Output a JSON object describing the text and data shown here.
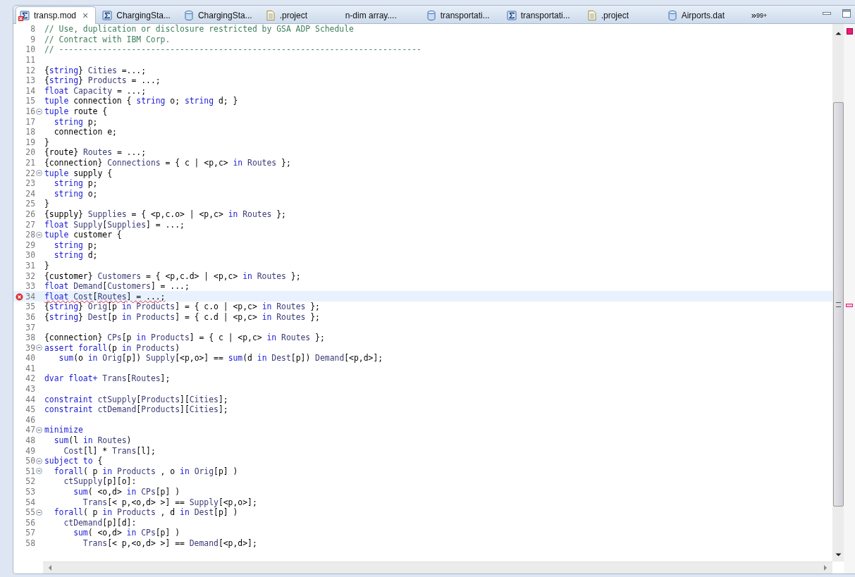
{
  "tabs": [
    {
      "label": "transp.mod",
      "kind": "model",
      "error": true,
      "selected": true,
      "close": "×"
    },
    {
      "label": "ChargingSta...",
      "kind": "model",
      "error": false,
      "selected": false
    },
    {
      "label": "ChargingSta...",
      "kind": "data",
      "error": false,
      "selected": false
    },
    {
      "label": ".project",
      "kind": "file",
      "error": false,
      "selected": false
    },
    {
      "label": "n-dim array....",
      "kind": "plain",
      "error": false,
      "selected": false
    },
    {
      "label": "transportati...",
      "kind": "data",
      "error": false,
      "selected": false
    },
    {
      "label": "transportati...",
      "kind": "model",
      "error": false,
      "selected": false
    },
    {
      "label": ".project",
      "kind": "file",
      "error": false,
      "selected": false
    },
    {
      "label": "Airports.dat",
      "kind": "data",
      "error": false,
      "selected": false
    }
  ],
  "overflow": {
    "chevron": "»",
    "count": "99+"
  },
  "lines": [
    {
      "n": "8",
      "fold": false,
      "error": false,
      "s": [
        {
          "kind": "comment",
          "text": "// Use, duplication or disclosure restricted by GSA ADP Schedule"
        }
      ]
    },
    {
      "n": "9",
      "fold": false,
      "error": false,
      "s": [
        {
          "kind": "comment",
          "text": "// Contract with IBM Corp."
        }
      ]
    },
    {
      "n": "10",
      "fold": false,
      "error": false,
      "s": [
        {
          "kind": "comment",
          "text": "// ---------------------------------------------------------------------------"
        }
      ]
    },
    {
      "n": "11",
      "fold": false,
      "error": false
    },
    {
      "n": "12",
      "fold": false,
      "error": false,
      "s": [
        {
          "kind": "plain",
          "text": "{"
        },
        {
          "kind": "kw",
          "text": "string"
        },
        {
          "kind": "plain",
          "text": "} "
        },
        {
          "kind": "name",
          "text": "Cities"
        },
        {
          "kind": "plain",
          "text": " =...;"
        }
      ]
    },
    {
      "n": "13",
      "fold": false,
      "error": false,
      "s": [
        {
          "kind": "plain",
          "text": "{"
        },
        {
          "kind": "kw",
          "text": "string"
        },
        {
          "kind": "plain",
          "text": "} "
        },
        {
          "kind": "name",
          "text": "Products"
        },
        {
          "kind": "plain",
          "text": " = ...;"
        }
      ]
    },
    {
      "n": "14",
      "fold": false,
      "error": false,
      "s": [
        {
          "kind": "kw",
          "text": "float"
        },
        {
          "kind": "name",
          "text": " Capacity"
        },
        {
          "kind": "plain",
          "text": " = ...;"
        }
      ]
    },
    {
      "n": "15",
      "fold": false,
      "error": false,
      "s": [
        {
          "kind": "kw",
          "text": "tuple"
        },
        {
          "kind": "plain",
          "text": " connection { "
        },
        {
          "kind": "kw",
          "text": "string"
        },
        {
          "kind": "plain",
          "text": " o; "
        },
        {
          "kind": "kw",
          "text": "string"
        },
        {
          "kind": "plain",
          "text": " d; }"
        }
      ]
    },
    {
      "n": "16",
      "fold": true,
      "error": false,
      "s": [
        {
          "kind": "kw",
          "text": "tuple"
        },
        {
          "kind": "plain",
          "text": " route {"
        }
      ]
    },
    {
      "n": "17",
      "fold": false,
      "error": false,
      "s": [
        {
          "kind": "kw",
          "text": "  string"
        },
        {
          "kind": "plain",
          "text": " p;"
        }
      ]
    },
    {
      "n": "18",
      "fold": false,
      "error": false,
      "s": [
        {
          "kind": "plain",
          "text": "  connection e;"
        }
      ]
    },
    {
      "n": "19",
      "fold": false,
      "error": false,
      "s": [
        {
          "kind": "plain",
          "text": "}"
        }
      ]
    },
    {
      "n": "20",
      "fold": false,
      "error": false,
      "s": [
        {
          "kind": "plain",
          "text": "{route} "
        },
        {
          "kind": "name",
          "text": "Routes"
        },
        {
          "kind": "plain",
          "text": " = ...;"
        }
      ]
    },
    {
      "n": "21",
      "fold": false,
      "error": false,
      "s": [
        {
          "kind": "plain",
          "text": "{connection} "
        },
        {
          "kind": "name",
          "text": "Connections"
        },
        {
          "kind": "plain",
          "text": " = { c | <p,c> "
        },
        {
          "kind": "kw",
          "text": "in"
        },
        {
          "kind": "name",
          "text": " Routes"
        },
        {
          "kind": "plain",
          "text": " };"
        }
      ]
    },
    {
      "n": "22",
      "fold": true,
      "error": false,
      "s": [
        {
          "kind": "kw",
          "text": "tuple"
        },
        {
          "kind": "plain",
          "text": " supply {"
        }
      ]
    },
    {
      "n": "23",
      "fold": false,
      "error": false,
      "s": [
        {
          "kind": "kw",
          "text": "  string"
        },
        {
          "kind": "plain",
          "text": " p;"
        }
      ]
    },
    {
      "n": "24",
      "fold": false,
      "error": false,
      "s": [
        {
          "kind": "kw",
          "text": "  string"
        },
        {
          "kind": "plain",
          "text": " o;"
        }
      ]
    },
    {
      "n": "25",
      "fold": false,
      "error": false,
      "s": [
        {
          "kind": "plain",
          "text": "}"
        }
      ]
    },
    {
      "n": "26",
      "fold": false,
      "error": false,
      "s": [
        {
          "kind": "plain",
          "text": "{supply} "
        },
        {
          "kind": "name",
          "text": "Supplies"
        },
        {
          "kind": "plain",
          "text": " = { <p,c.o> | <p,c> "
        },
        {
          "kind": "kw",
          "text": "in"
        },
        {
          "kind": "name",
          "text": " Routes"
        },
        {
          "kind": "plain",
          "text": " };"
        }
      ]
    },
    {
      "n": "27",
      "fold": false,
      "error": false,
      "s": [
        {
          "kind": "kw",
          "text": "float"
        },
        {
          "kind": "name",
          "text": " Supply"
        },
        {
          "kind": "plain",
          "text": "["
        },
        {
          "kind": "name",
          "text": "Supplies"
        },
        {
          "kind": "plain",
          "text": "] = ...;"
        }
      ]
    },
    {
      "n": "28",
      "fold": true,
      "error": false,
      "s": [
        {
          "kind": "kw",
          "text": "tuple"
        },
        {
          "kind": "plain",
          "text": " customer {"
        }
      ]
    },
    {
      "n": "29",
      "fold": false,
      "error": false,
      "s": [
        {
          "kind": "kw",
          "text": "  string"
        },
        {
          "kind": "plain",
          "text": " p;"
        }
      ]
    },
    {
      "n": "30",
      "fold": false,
      "error": false,
      "s": [
        {
          "kind": "kw",
          "text": "  string"
        },
        {
          "kind": "plain",
          "text": " d;"
        }
      ]
    },
    {
      "n": "31",
      "fold": false,
      "error": false,
      "s": [
        {
          "kind": "plain",
          "text": "}"
        }
      ]
    },
    {
      "n": "32",
      "fold": false,
      "error": false,
      "s": [
        {
          "kind": "plain",
          "text": "{customer} "
        },
        {
          "kind": "name",
          "text": "Customers"
        },
        {
          "kind": "plain",
          "text": " = { <p,c.d> | <p,c> "
        },
        {
          "kind": "kw",
          "text": "in"
        },
        {
          "kind": "name",
          "text": " Routes"
        },
        {
          "kind": "plain",
          "text": " };"
        }
      ]
    },
    {
      "n": "33",
      "fold": false,
      "error": false,
      "s": [
        {
          "kind": "kw",
          "text": "float"
        },
        {
          "kind": "name",
          "text": " Demand"
        },
        {
          "kind": "plain",
          "text": "["
        },
        {
          "kind": "name",
          "text": "Customers"
        },
        {
          "kind": "plain",
          "text": "] = ...;"
        }
      ]
    },
    {
      "n": "34",
      "fold": false,
      "error": true,
      "s": [
        {
          "kind": "kw",
          "text": "float"
        },
        {
          "kind": "name",
          "text": " Cost"
        },
        {
          "kind": "plain",
          "text": "["
        },
        {
          "kind": "name",
          "text": "Routes"
        },
        {
          "kind": "plain",
          "text": "] = ...;"
        }
      ]
    },
    {
      "n": "35",
      "fold": false,
      "error": false,
      "s": [
        {
          "kind": "plain",
          "text": "{"
        },
        {
          "kind": "kw",
          "text": "string"
        },
        {
          "kind": "plain",
          "text": "} "
        },
        {
          "kind": "name",
          "text": "Orig"
        },
        {
          "kind": "plain",
          "text": "[p "
        },
        {
          "kind": "kw",
          "text": "in"
        },
        {
          "kind": "name",
          "text": " Products"
        },
        {
          "kind": "plain",
          "text": "] = { c.o | <p,c> "
        },
        {
          "kind": "kw",
          "text": "in"
        },
        {
          "kind": "name",
          "text": " Routes"
        },
        {
          "kind": "plain",
          "text": " };"
        }
      ]
    },
    {
      "n": "36",
      "fold": false,
      "error": false,
      "s": [
        {
          "kind": "plain",
          "text": "{"
        },
        {
          "kind": "kw",
          "text": "string"
        },
        {
          "kind": "plain",
          "text": "} "
        },
        {
          "kind": "name",
          "text": "Dest"
        },
        {
          "kind": "plain",
          "text": "[p "
        },
        {
          "kind": "kw",
          "text": "in"
        },
        {
          "kind": "name",
          "text": " Products"
        },
        {
          "kind": "plain",
          "text": "] = { c.d | <p,c> "
        },
        {
          "kind": "kw",
          "text": "in"
        },
        {
          "kind": "name",
          "text": " Routes"
        },
        {
          "kind": "plain",
          "text": " };"
        }
      ]
    },
    {
      "n": "37",
      "fold": false,
      "error": false
    },
    {
      "n": "38",
      "fold": false,
      "error": false,
      "s": [
        {
          "kind": "plain",
          "text": "{connection} "
        },
        {
          "kind": "name",
          "text": "CPs"
        },
        {
          "kind": "plain",
          "text": "[p "
        },
        {
          "kind": "kw",
          "text": "in"
        },
        {
          "kind": "name",
          "text": " Products"
        },
        {
          "kind": "plain",
          "text": "] = { c | <p,c> "
        },
        {
          "kind": "kw",
          "text": "in"
        },
        {
          "kind": "name",
          "text": " Routes"
        },
        {
          "kind": "plain",
          "text": " };"
        }
      ]
    },
    {
      "n": "39",
      "fold": true,
      "error": false,
      "s": [
        {
          "kind": "kw",
          "text": "assert forall"
        },
        {
          "kind": "plain",
          "text": "(p "
        },
        {
          "kind": "kw",
          "text": "in"
        },
        {
          "kind": "name",
          "text": " Products"
        },
        {
          "kind": "plain",
          "text": ")"
        }
      ]
    },
    {
      "n": "40",
      "fold": false,
      "error": false,
      "s": [
        {
          "kind": "kw",
          "text": "   sum"
        },
        {
          "kind": "plain",
          "text": "(o "
        },
        {
          "kind": "kw",
          "text": "in"
        },
        {
          "kind": "name",
          "text": " Orig"
        },
        {
          "kind": "plain",
          "text": "[p]) "
        },
        {
          "kind": "name",
          "text": "Supply"
        },
        {
          "kind": "plain",
          "text": "[<p,o>] == "
        },
        {
          "kind": "kw",
          "text": "sum"
        },
        {
          "kind": "plain",
          "text": "(d "
        },
        {
          "kind": "kw",
          "text": "in"
        },
        {
          "kind": "name",
          "text": " Dest"
        },
        {
          "kind": "plain",
          "text": "[p]) "
        },
        {
          "kind": "name",
          "text": "Demand"
        },
        {
          "kind": "plain",
          "text": "[<p,d>];"
        }
      ]
    },
    {
      "n": "41",
      "fold": false,
      "error": false
    },
    {
      "n": "42",
      "fold": false,
      "error": false,
      "s": [
        {
          "kind": "kw",
          "text": "dvar float+"
        },
        {
          "kind": "name",
          "text": " Trans"
        },
        {
          "kind": "plain",
          "text": "["
        },
        {
          "kind": "name",
          "text": "Routes"
        },
        {
          "kind": "plain",
          "text": "];"
        }
      ]
    },
    {
      "n": "43",
      "fold": false,
      "error": false
    },
    {
      "n": "44",
      "fold": false,
      "error": false,
      "s": [
        {
          "kind": "kw",
          "text": "constraint"
        },
        {
          "kind": "name",
          "text": " ctSupply"
        },
        {
          "kind": "plain",
          "text": "["
        },
        {
          "kind": "name",
          "text": "Products"
        },
        {
          "kind": "plain",
          "text": "]["
        },
        {
          "kind": "name",
          "text": "Cities"
        },
        {
          "kind": "plain",
          "text": "];"
        }
      ]
    },
    {
      "n": "45",
      "fold": false,
      "error": false,
      "s": [
        {
          "kind": "kw",
          "text": "constraint"
        },
        {
          "kind": "name",
          "text": " ctDemand"
        },
        {
          "kind": "plain",
          "text": "["
        },
        {
          "kind": "name",
          "text": "Products"
        },
        {
          "kind": "plain",
          "text": "]["
        },
        {
          "kind": "name",
          "text": "Cities"
        },
        {
          "kind": "plain",
          "text": "];"
        }
      ]
    },
    {
      "n": "46",
      "fold": false,
      "error": false
    },
    {
      "n": "47",
      "fold": true,
      "error": false,
      "s": [
        {
          "kind": "kw",
          "text": "minimize"
        }
      ]
    },
    {
      "n": "48",
      "fold": false,
      "error": false,
      "s": [
        {
          "kind": "kw",
          "text": "  sum"
        },
        {
          "kind": "plain",
          "text": "(l "
        },
        {
          "kind": "kw",
          "text": "in"
        },
        {
          "kind": "name",
          "text": " Routes"
        },
        {
          "kind": "plain",
          "text": ")"
        }
      ]
    },
    {
      "n": "49",
      "fold": false,
      "error": false,
      "s": [
        {
          "kind": "name",
          "text": "    Cost"
        },
        {
          "kind": "plain",
          "text": "[l] * "
        },
        {
          "kind": "name",
          "text": "Trans"
        },
        {
          "kind": "plain",
          "text": "[l];"
        }
      ]
    },
    {
      "n": "50",
      "fold": true,
      "error": false,
      "s": [
        {
          "kind": "kw",
          "text": "subject to"
        },
        {
          "kind": "plain",
          "text": " {"
        }
      ]
    },
    {
      "n": "51",
      "fold": true,
      "error": false,
      "s": [
        {
          "kind": "kw",
          "text": "  forall"
        },
        {
          "kind": "plain",
          "text": "( p "
        },
        {
          "kind": "kw",
          "text": "in"
        },
        {
          "kind": "name",
          "text": " Products"
        },
        {
          "kind": "plain",
          "text": " , o "
        },
        {
          "kind": "kw",
          "text": "in"
        },
        {
          "kind": "name",
          "text": " Orig"
        },
        {
          "kind": "plain",
          "text": "[p] )"
        }
      ]
    },
    {
      "n": "52",
      "fold": false,
      "error": false,
      "s": [
        {
          "kind": "name",
          "text": "    ctSupply"
        },
        {
          "kind": "plain",
          "text": "[p][o]:"
        }
      ]
    },
    {
      "n": "53",
      "fold": false,
      "error": false,
      "s": [
        {
          "kind": "kw",
          "text": "      sum"
        },
        {
          "kind": "plain",
          "text": "( <o,d> "
        },
        {
          "kind": "kw",
          "text": "in"
        },
        {
          "kind": "name",
          "text": " CPs"
        },
        {
          "kind": "plain",
          "text": "[p] )"
        }
      ]
    },
    {
      "n": "54",
      "fold": false,
      "error": false,
      "s": [
        {
          "kind": "name",
          "text": "        Trans"
        },
        {
          "kind": "plain",
          "text": "[< p,<o,d> >] == "
        },
        {
          "kind": "name",
          "text": "Supply"
        },
        {
          "kind": "plain",
          "text": "[<p,o>];"
        }
      ]
    },
    {
      "n": "55",
      "fold": true,
      "error": false,
      "s": [
        {
          "kind": "kw",
          "text": "  forall"
        },
        {
          "kind": "plain",
          "text": "( p "
        },
        {
          "kind": "kw",
          "text": "in"
        },
        {
          "kind": "name",
          "text": " Products"
        },
        {
          "kind": "plain",
          "text": " , d "
        },
        {
          "kind": "kw",
          "text": "in"
        },
        {
          "kind": "name",
          "text": " Dest"
        },
        {
          "kind": "plain",
          "text": "[p] )"
        }
      ]
    },
    {
      "n": "56",
      "fold": false,
      "error": false,
      "s": [
        {
          "kind": "name",
          "text": "    ctDemand"
        },
        {
          "kind": "plain",
          "text": "[p][d]:"
        }
      ]
    },
    {
      "n": "57",
      "fold": false,
      "error": false,
      "s": [
        {
          "kind": "kw",
          "text": "      sum"
        },
        {
          "kind": "plain",
          "text": "( <o,d> "
        },
        {
          "kind": "kw",
          "text": "in"
        },
        {
          "kind": "name",
          "text": " CPs"
        },
        {
          "kind": "plain",
          "text": "[p] )"
        }
      ]
    },
    {
      "n": "58",
      "fold": false,
      "error": false,
      "s": [
        {
          "kind": "name",
          "text": "        Trans"
        },
        {
          "kind": "plain",
          "text": "[< p,<o,d> >] == "
        },
        {
          "kind": "name",
          "text": "Demand"
        },
        {
          "kind": "plain",
          "text": "[<p,d>];"
        }
      ]
    }
  ]
}
